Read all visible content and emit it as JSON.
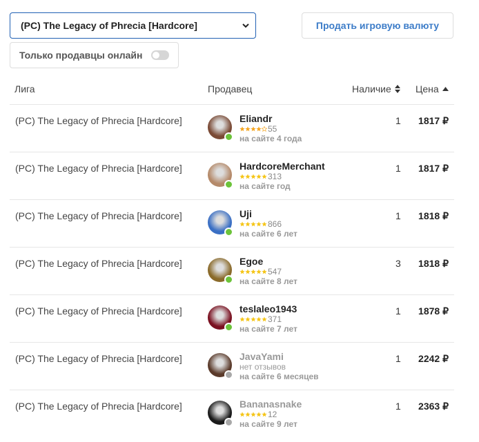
{
  "filters": {
    "game_select_value": "(PC) The Legacy of Phrecia [Hardcore]",
    "sell_button_label": "Продать игровую валюту",
    "online_only_label": "Только продавцы онлайн",
    "online_only_enabled": false
  },
  "table": {
    "headers": {
      "league": "Лига",
      "seller": "Продавец",
      "stock": "Наличие",
      "price": "Цена"
    },
    "rows": [
      {
        "league": "(PC) The Legacy of Phrecia [Hardcore]",
        "seller": "Eliandr",
        "online": true,
        "stars": 4,
        "reviews": "55",
        "since": "на сайте 4 года",
        "stock": "1",
        "price": "1817 ₽",
        "avatar_color": "#7a4a35"
      },
      {
        "league": "(PC) The Legacy of Phrecia [Hardcore]",
        "seller": "HardcoreMerchant",
        "online": true,
        "stars": 5,
        "reviews": "313",
        "since": "на сайте год",
        "stock": "1",
        "price": "1817 ₽",
        "avatar_color": "#b58a6a"
      },
      {
        "league": "(PC) The Legacy of Phrecia [Hardcore]",
        "seller": "Uji",
        "online": true,
        "stars": 5,
        "reviews": "866",
        "since": "на сайте 6 лет",
        "stock": "1",
        "price": "1818 ₽",
        "avatar_color": "#3a6fc4"
      },
      {
        "league": "(PC) The Legacy of Phrecia [Hardcore]",
        "seller": "Egoe",
        "online": true,
        "stars": 5,
        "reviews": "547",
        "since": "на сайте 8 лет",
        "stock": "3",
        "price": "1818 ₽",
        "avatar_color": "#8a6a2a"
      },
      {
        "league": "(PC) The Legacy of Phrecia [Hardcore]",
        "seller": "teslaleo1943",
        "online": true,
        "stars": 5,
        "reviews": "371",
        "since": "на сайте 7 лет",
        "stock": "1",
        "price": "1878 ₽",
        "avatar_color": "#7a1020"
      },
      {
        "league": "(PC) The Legacy of Phrecia [Hardcore]",
        "seller": "JavaYami",
        "online": false,
        "stars": 0,
        "reviews": "",
        "no_reviews": "нет отзывов",
        "since": "на сайте 6 месяцев",
        "stock": "1",
        "price": "2242 ₽",
        "avatar_color": "#5a3a2a"
      },
      {
        "league": "(PC) The Legacy of Phrecia [Hardcore]",
        "seller": "Bananasnake",
        "online": false,
        "stars": 5,
        "reviews": "12",
        "since": "на сайте 9 лет",
        "stock": "1",
        "price": "2363 ₽",
        "avatar_color": "#1a1a1a"
      }
    ]
  },
  "colors": {
    "online": "#6cc33a",
    "offline": "#a8a8a8",
    "star_filled": "#f5c518",
    "star_half": "#f5a623",
    "accent": "#3c7cc8"
  }
}
